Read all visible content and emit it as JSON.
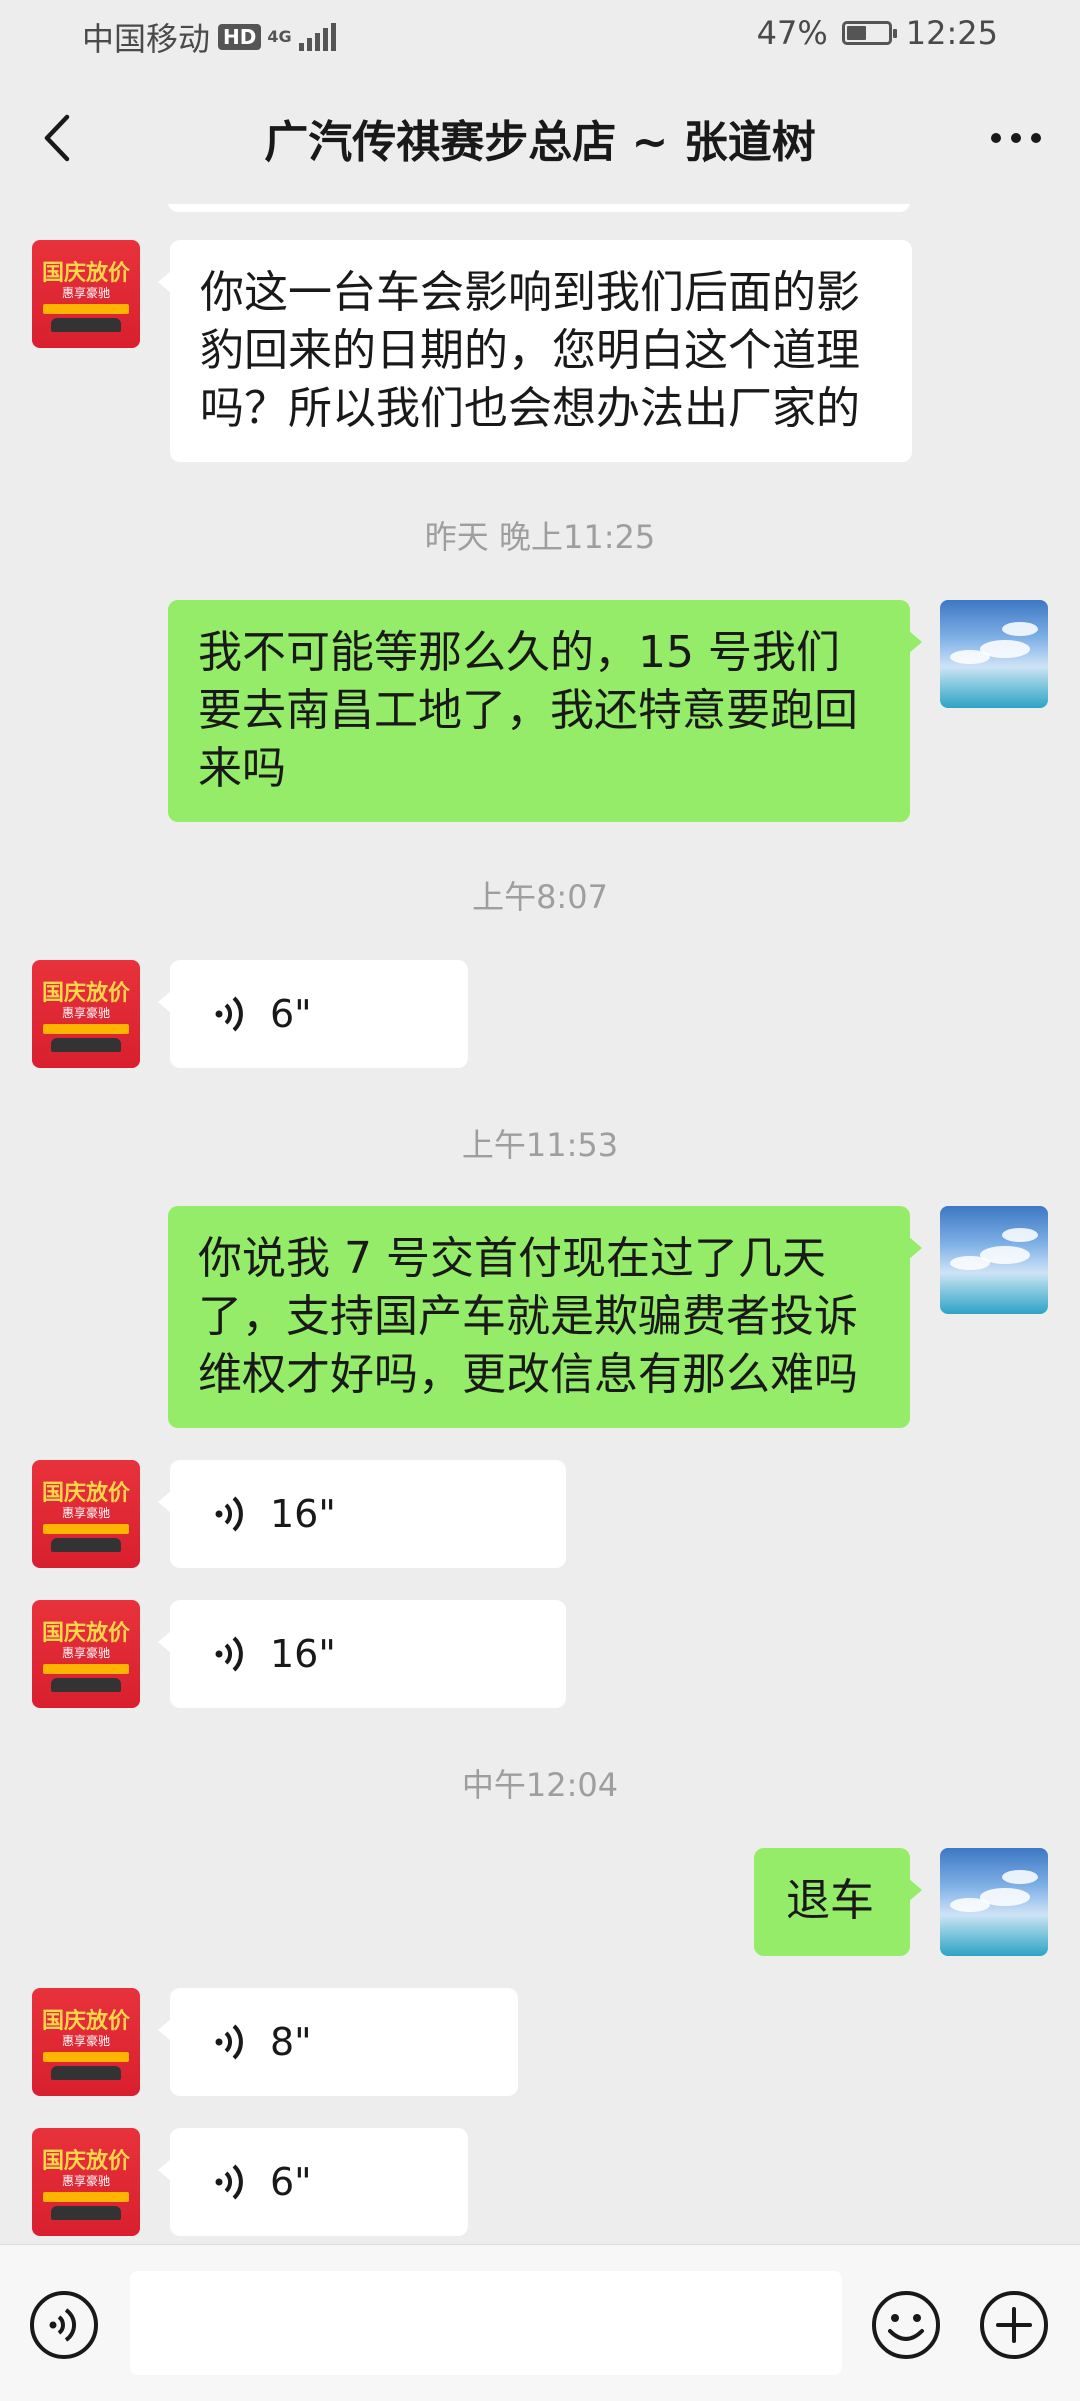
{
  "status_bar": {
    "carrier": "中国移动",
    "hd": "HD",
    "network": "4G",
    "battery": "47%",
    "battery_level": 0.47,
    "time": "12:25"
  },
  "header": {
    "title": "广汽传祺赛步总店 ~ 张道树"
  },
  "messages": [
    {
      "text": "你这一台车会影响到我们后面的影豹回来的日期的，您明白这个道理吗？所以我们也会想办法出厂家的"
    },
    {
      "time": "昨天 晚上11:25"
    },
    {
      "text": "我不可能等那么久的，15 号我们要去南昌工地了，我还特意要跑回来吗"
    },
    {
      "time": "上午8:07"
    },
    {
      "duration": "6\""
    },
    {
      "time": "上午11:53"
    },
    {
      "text": "你说我 7 号交首付现在过了几天了，支持国产车就是欺骗费者投诉维权才好吗，更改信息有那么难吗"
    },
    {
      "duration": "16\""
    },
    {
      "duration": "16\""
    },
    {
      "time": "中午12:04"
    },
    {
      "text": "退车"
    },
    {
      "duration": "8\""
    },
    {
      "duration": "6\""
    }
  ],
  "avatar_store": {
    "line1": "国庆放价",
    "line2": "惠享豪驰"
  },
  "colors": {
    "background": "#ededed",
    "incoming_bubble": "#ffffff",
    "outgoing_bubble": "#95ec69",
    "timestamp_text": "#9e9e9e"
  },
  "icons": {
    "back": "chevron-left-icon",
    "more": "more-dots-icon",
    "voice": "voice-wave-icon",
    "voice_mode": "voice-mode-icon",
    "emoji": "emoji-icon",
    "plus": "plus-icon"
  }
}
